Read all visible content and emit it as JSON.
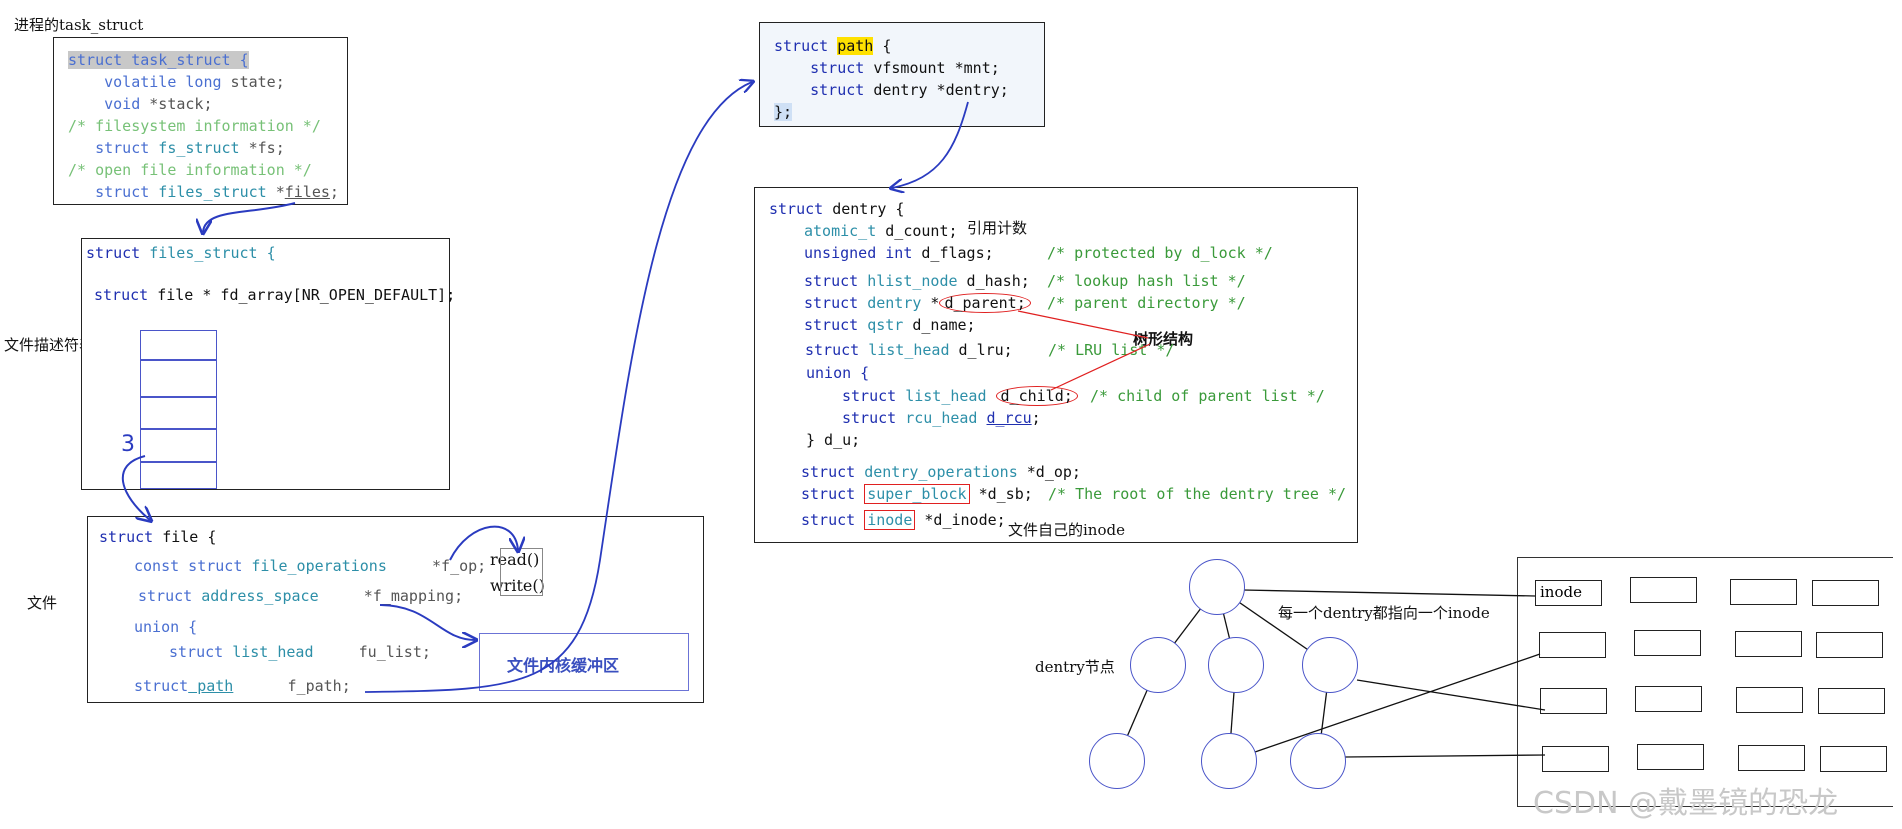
{
  "labels": {
    "task_struct_title": "进程的task_struct",
    "fd_table": "文件描述符表",
    "file": "文件",
    "index_3": "3",
    "refcount": "引用计数",
    "tree": "树形结构",
    "own_inode": "文件自己的inode",
    "dentry_node": "dentry节点",
    "each_dentry": "每一个dentry都指向一个inode",
    "kernel_buffer": "文件内核缓冲区",
    "read": "read()",
    "write": "write()",
    "inode_cell": "inode",
    "watermark": "CSDN @戴墨镜的恐龙"
  },
  "task_struct": {
    "l1_kw": "struct task_struct {",
    "l2_kw": "volatile long",
    "l2_tx": " state;",
    "l3_kw": "void",
    "l3_tx": " *stack;",
    "l4_cm": "/* filesystem information */",
    "l5_kw": "struct",
    "l5_ty": " fs_struct",
    "l5_tx": " *fs;",
    "l6_cm": "/* open file information */",
    "l7_kw": "struct",
    "l7_ty": " files_struct",
    "l7_tx1": " *",
    "l7_tx2": "files",
    "l7_tx3": ";"
  },
  "files_struct": {
    "l1_kw": "struct ",
    "l1_ty": "files_struct {",
    "l2_kw": "struct",
    "l2_tx": " file * fd_array[NR_OPEN_DEFAULT];"
  },
  "file_struct": {
    "l1_kw": "struct",
    "l1_tx": " file {",
    "l2_kw": "const struct",
    "l2_ty": " file_operations",
    "l2_tx": "     *f_op;",
    "l3_kw": "struct",
    "l3_ty": " address_space",
    "l3_tx": "     *f_mapping;",
    "l4_kw": "union {",
    "l5_kw": "struct",
    "l5_ty": " list_head",
    "l5_tx": "     fu_list;",
    "l6_kw": "struct",
    "l6_ty": " path",
    "l6_tx": "      f_path;"
  },
  "path_struct": {
    "l1_kw": "struct ",
    "l1_hl": "path",
    "l1_tx": " {",
    "l2_kw": "struct",
    "l2_tx": " vfsmount *mnt;",
    "l3_kw": "struct",
    "l3_tx": " dentry *dentry;",
    "l4_tx": "};"
  },
  "dentry_struct": {
    "l1_kw": "struct",
    "l1_tx": " dentry {",
    "l2_ty": "atomic_t",
    "l2_tx": " d_count;",
    "l3_kw": "unsigned int",
    "l3_tx": " d_flags;",
    "l3_cm": "/* protected by d_lock */",
    "l4_kw": "struct",
    "l4_ty": " hlist_node",
    "l4_tx": " d_hash;",
    "l4_cm": "/* lookup hash list */",
    "l5_kw": "struct",
    "l5_ty": " dentry",
    "l5_tx1": " *",
    "l5_ov": "d_parent;",
    "l5_cm": "/* parent directory */",
    "l6_kw": "struct",
    "l6_ty": " qstr",
    "l6_tx": " d_name;",
    "l7_kw": "struct",
    "l7_ty": " list_head",
    "l7_tx": " d_lru;",
    "l7_cm": "/* LRU list */",
    "l8_kw": "union {",
    "l9_kw": "struct",
    "l9_ty": " list_head",
    "l9_ov": "d_child;",
    "l9_cm": "/* child of parent list */",
    "l10_kw": "struct",
    "l10_ty": " rcu_head",
    "l10_ul": "d_rcu",
    "l10_tx": ";",
    "l11_tx": "} d_u;",
    "l12_kw": "struct",
    "l12_ty": " dentry_operations",
    "l12_tx": " *d_op;",
    "l13_kw": "struct",
    "l13_box": "super_block",
    "l13_tx": " *d_sb;",
    "l13_cm": "/* The root of the dentry tree */",
    "l14_kw": "struct",
    "l14_box": "inode",
    "l14_tx": " *d_inode;"
  }
}
